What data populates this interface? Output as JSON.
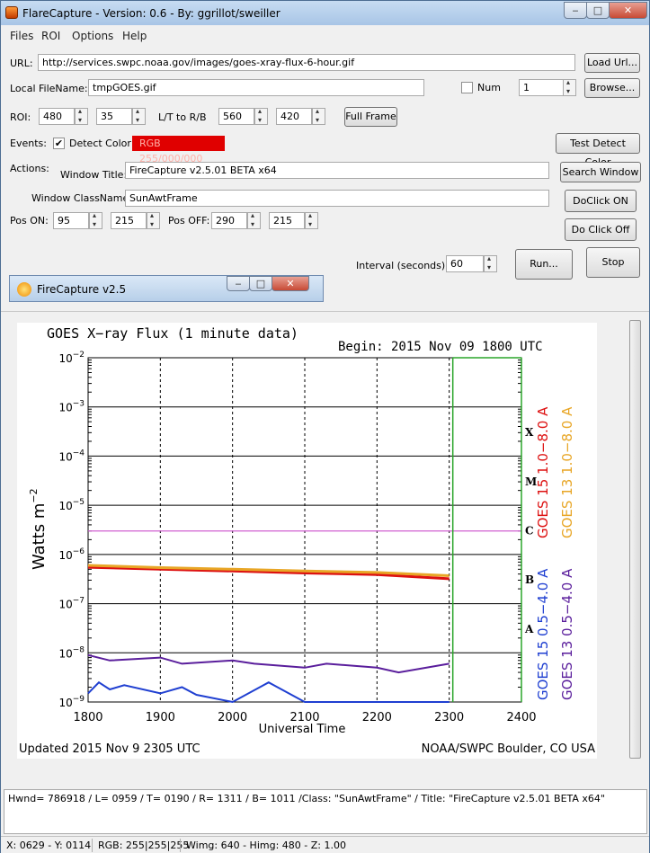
{
  "window": {
    "title": "FlareCapture - Version: 0.6 - By: ggrillot/sweiller"
  },
  "menu": [
    "Files",
    "ROI",
    "Options",
    "Help"
  ],
  "url": {
    "label": "URL:",
    "value": "http://services.swpc.noaa.gov/images/goes-xray-flux-6-hour.gif",
    "load_btn": "Load Url..."
  },
  "local": {
    "label": "Local FileName:",
    "value": "tmpGOES.gif",
    "num_label": "Num",
    "num_checked": false,
    "num_value": "1",
    "browse_btn": "Browse..."
  },
  "roi": {
    "label": "ROI:",
    "x": "480",
    "y": "35",
    "ltrb_label": "L/T to R/B",
    "r": "560",
    "b": "420",
    "full_frame_btn": "Full Frame"
  },
  "events": {
    "label": "Events:",
    "detect_label": "Detect Color",
    "detect_checked": true,
    "rgb_text": "RGB 255/000/000",
    "rgb_color": "#e00000",
    "test_btn": "Test Detect Color"
  },
  "actions": {
    "label": "Actions:",
    "window_title_label": "Window Title:",
    "window_title": "FireCapture v2.5.01 BETA x64",
    "search_btn": "Search Window",
    "classname_label": "Window ClassName:",
    "classname": "SunAwtFrame",
    "doclick_on_btn": "DoClick ON",
    "doclick_off_btn": "Do Click Off",
    "pos_on_label": "Pos ON:",
    "pos_on_x": "95",
    "pos_on_y": "215",
    "pos_off_label": "Pos OFF:",
    "pos_off_x": "290",
    "pos_off_y": "215"
  },
  "interval": {
    "label": "Interval (seconds):",
    "value": "60",
    "run_btn": "Run...",
    "stop_btn": "Stop"
  },
  "subwindow": {
    "title": "FireCapture v2.5"
  },
  "chart_data": {
    "type": "line",
    "title": "GOES X−ray Flux (1 minute data)",
    "subtitle": "Begin: 2015 Nov 09 1800 UTC",
    "xlabel": "Universal Time",
    "ylabel": "Watts m",
    "ylabel_sup": "−2",
    "y_scale": "log",
    "ylim": [
      1e-09,
      0.01
    ],
    "xlim": [
      1800,
      2400
    ],
    "x_ticks": [
      "1800",
      "1900",
      "2000",
      "2100",
      "2200",
      "2300",
      "2400"
    ],
    "y_ticks": [
      {
        "base": "10",
        "exp": "−2",
        "v": -2
      },
      {
        "base": "10",
        "exp": "−3",
        "v": -3
      },
      {
        "base": "10",
        "exp": "−4",
        "v": -4
      },
      {
        "base": "10",
        "exp": "−5",
        "v": -5
      },
      {
        "base": "10",
        "exp": "−6",
        "v": -6
      },
      {
        "base": "10",
        "exp": "−7",
        "v": -7
      },
      {
        "base": "10",
        "exp": "−8",
        "v": -8
      },
      {
        "base": "10",
        "exp": "−9",
        "v": -9
      }
    ],
    "flare_classes": [
      {
        "label": "X",
        "v": -3.5
      },
      {
        "label": "M",
        "v": -4.5
      },
      {
        "label": "C",
        "v": -5.5
      },
      {
        "label": "B",
        "v": -6.5
      },
      {
        "label": "A",
        "v": -7.5
      }
    ],
    "footer_left": "Updated 2015 Nov  9 2305 UTC",
    "footer_right": "NOAA/SWPC Boulder, CO USA",
    "legend": [
      {
        "name": "GOES 15 1.0−8.0 A",
        "color": "#dd1111"
      },
      {
        "name": "GOES 13 1.0−8.0 A",
        "color": "#e8a626"
      },
      {
        "name": "GOES 15 0.5−4.0 A",
        "color": "#1f3fd1"
      },
      {
        "name": "GOES 13 0.5−4.0 A",
        "color": "#5a1e9c"
      }
    ],
    "series": [
      {
        "name": "GOES 15 1.0−8.0 A",
        "color": "#dd1111",
        "x": [
          1800,
          1900,
          2000,
          2100,
          2200,
          2300
        ],
        "y": [
          5.5e-07,
          5e-07,
          4.6e-07,
          4.2e-07,
          3.9e-07,
          3.2e-07
        ]
      },
      {
        "name": "GOES 13 1.0−8.0 A",
        "color": "#e8a626",
        "x": [
          1800,
          1900,
          2000,
          2100,
          2200,
          2300
        ],
        "y": [
          6e-07,
          5.4e-07,
          5e-07,
          4.6e-07,
          4.3e-07,
          3.7e-07
        ]
      },
      {
        "name": "GOES 13 0.5−4.0 A",
        "color": "#5a1e9c",
        "x": [
          1800,
          1830,
          1900,
          1930,
          2000,
          2030,
          2100,
          2130,
          2200,
          2230,
          2300
        ],
        "y": [
          9e-09,
          7e-09,
          8e-09,
          6e-09,
          7e-09,
          6e-09,
          5e-09,
          6e-09,
          5e-09,
          4e-09,
          6e-09
        ]
      },
      {
        "name": "GOES 15 0.5−4.0 A",
        "color": "#1f3fd1",
        "x": [
          1800,
          1815,
          1830,
          1850,
          1900,
          1930,
          1950,
          2000,
          2050,
          2100,
          2130,
          2200,
          2230,
          2300
        ],
        "y": [
          1.5e-09,
          2.5e-09,
          1.8e-09,
          2.2e-09,
          1.5e-09,
          2e-09,
          1.4e-09,
          1e-09,
          2.5e-09,
          1e-09,
          1e-09,
          1e-09,
          1e-09,
          1e-09
        ]
      }
    ],
    "reference_line": {
      "y": 3e-06,
      "color": "#d060d0"
    },
    "now_line": {
      "x": 2305,
      "color": "#2aa52a"
    }
  },
  "log": {
    "text": "Hwnd= 786918 / L= 0959 / T= 0190 / R= 1311 / B= 1011 /Class: \"SunAwtFrame\" / Title: \"FireCapture v2.5.01 BETA x64\""
  },
  "status": {
    "xy": "X: 0629 - Y: 0114",
    "rgb": "RGB: 255|255|255",
    "size": "Wimg: 640 - Himg: 480 - Z: 1.00"
  }
}
